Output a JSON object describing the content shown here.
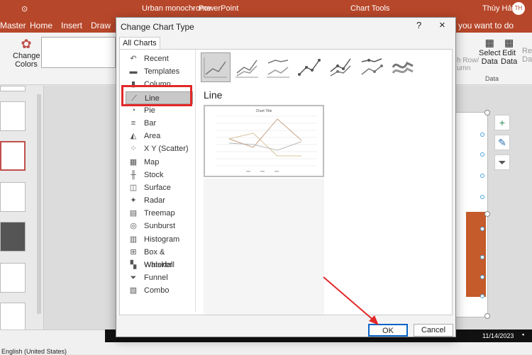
{
  "app": {
    "file_title": "Urban monochrome",
    "app_name": "PowerPoint",
    "contextual_tab": "Chart Tools",
    "user_name": "Thùy Hải",
    "user_initials": "TH",
    "tabs": [
      "Master",
      "Home",
      "Insert",
      "Draw"
    ],
    "tell_me": "you want to do"
  },
  "ribbon": {
    "change_colors_1": "Change",
    "change_colors_2": "Colors",
    "select_data_1": "Select",
    "select_data_2": "Data",
    "edit_data_1": "Edit",
    "edit_data_2": "Data",
    "refresh_1": "Refre",
    "refresh_2": "Dat",
    "switch_1": "h Row/",
    "switch_2": "umn",
    "group_data": "Data"
  },
  "status": {
    "language": "English (United States)",
    "date": "11/14/2023"
  },
  "dialog": {
    "title": "Change Chart Type",
    "help": "?",
    "close": "×",
    "tab": "All Charts",
    "heading": "Line",
    "ok": "OK",
    "cancel": "Cancel",
    "chart_types": [
      {
        "label": "Recent",
        "icon": "recent-icon",
        "glyph": "↶"
      },
      {
        "label": "Templates",
        "icon": "folder-icon",
        "glyph": "▬"
      },
      {
        "label": "Column",
        "icon": "column-chart-icon",
        "glyph": "▮"
      },
      {
        "label": "Line",
        "icon": "line-chart-icon",
        "glyph": "⟋"
      },
      {
        "label": "Pie",
        "icon": "pie-chart-icon",
        "glyph": "◔"
      },
      {
        "label": "Bar",
        "icon": "bar-chart-icon",
        "glyph": "≡"
      },
      {
        "label": "Area",
        "icon": "area-chart-icon",
        "glyph": "◭"
      },
      {
        "label": "X Y (Scatter)",
        "icon": "scatter-chart-icon",
        "glyph": "⁘"
      },
      {
        "label": "Map",
        "icon": "map-chart-icon",
        "glyph": "▦"
      },
      {
        "label": "Stock",
        "icon": "stock-chart-icon",
        "glyph": "╫"
      },
      {
        "label": "Surface",
        "icon": "surface-chart-icon",
        "glyph": "◫"
      },
      {
        "label": "Radar",
        "icon": "radar-chart-icon",
        "glyph": "✦"
      },
      {
        "label": "Treemap",
        "icon": "treemap-chart-icon",
        "glyph": "▤"
      },
      {
        "label": "Sunburst",
        "icon": "sunburst-chart-icon",
        "glyph": "◎"
      },
      {
        "label": "Histogram",
        "icon": "histogram-chart-icon",
        "glyph": "▥"
      },
      {
        "label": "Box & Whisker",
        "icon": "box-whisker-chart-icon",
        "glyph": "⊞"
      },
      {
        "label": "Waterfall",
        "icon": "waterfall-chart-icon",
        "glyph": "▚"
      },
      {
        "label": "Funnel",
        "icon": "funnel-chart-icon",
        "glyph": "⏷"
      },
      {
        "label": "Combo",
        "icon": "combo-chart-icon",
        "glyph": "▧"
      }
    ],
    "preview": {
      "title": "Chart Title"
    }
  },
  "colors": {
    "accent": "#b7472a",
    "highlight": "#e22828",
    "ok_border": "#0a64c8"
  }
}
